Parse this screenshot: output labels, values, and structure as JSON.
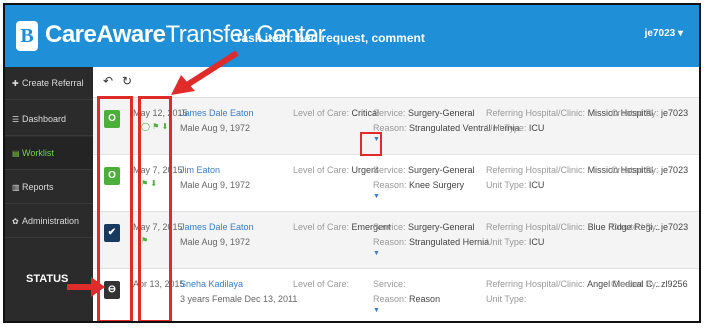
{
  "header": {
    "brand_bold": "CareAware",
    "brand_light": "Transfer Center",
    "user": "je7023 ▾",
    "logo_letter": "B"
  },
  "sidebar": {
    "items": [
      {
        "label": "Create Referral",
        "icon": "plus-icon"
      },
      {
        "label": "Dashboard",
        "icon": "grid-icon"
      },
      {
        "label": "Worklist",
        "icon": "list-icon"
      },
      {
        "label": "Reports",
        "icon": "chart-icon"
      },
      {
        "label": "Administration",
        "icon": "gear-icon"
      }
    ]
  },
  "toolbar": {
    "undo_icon": "undo-icon",
    "refresh_icon": "refresh-icon"
  },
  "annotations": {
    "task_label": "Task item: bed request, comment",
    "status_label": "STATUS",
    "color": "#e02b2b"
  },
  "rows": [
    {
      "status_color": "green",
      "status_icon": "circle-icon",
      "date": "May 12, 2015",
      "task_icons": "◯ ⚑ ⬇",
      "name": "James Dale Eaton",
      "info": "Male Aug 9, 1972",
      "care_label": "Level of Care:",
      "care": "Critical",
      "service_label": "Service:",
      "service": "Surgery-General",
      "reason_label": "Reason:",
      "reason": "Strangulated Ventral Hernia",
      "ref_label": "Referring Hospital/Clinic:",
      "ref": "Mission Hospital",
      "unit_label": "Unit Type:",
      "unit": "ICU",
      "created_label": "Created By:",
      "created": "je7023"
    },
    {
      "status_color": "green",
      "status_icon": "circle-icon",
      "date": "May 7, 2015",
      "task_icons": "⚑ ⬇",
      "name": "Jim Eaton",
      "info": "Male Aug 9, 1972",
      "care_label": "Level of Care:",
      "care": "Urgent",
      "service_label": "Service:",
      "service": "Surgery-General",
      "reason_label": "Reason:",
      "reason": "Knee Surgery",
      "ref_label": "Referring Hospital/Clinic:",
      "ref": "Mission Hospital",
      "unit_label": "Unit Type:",
      "unit": "ICU",
      "created_label": "Created By:",
      "created": "je7023"
    },
    {
      "status_color": "navy",
      "status_icon": "check-icon",
      "date": "May 7, 2015",
      "task_icons": "⚑",
      "name": "James Dale Eaton",
      "info": "Male Aug 9, 1972",
      "care_label": "Level of Care:",
      "care": "Emergent",
      "service_label": "Service:",
      "service": "Surgery-General",
      "reason_label": "Reason:",
      "reason": "Strangulated Hernia",
      "ref_label": "Referring Hospital/Clinic:",
      "ref": "Blue Ridge Regi...",
      "unit_label": "Unit Type:",
      "unit": "ICU",
      "created_label": "Created By:",
      "created": "je7023"
    },
    {
      "status_color": "dark",
      "status_icon": "minus-icon",
      "date": "Apr 13, 2015",
      "task_icons": "",
      "name": "Sneha Kadilaya",
      "info": "3 years Female Dec 13, 2011",
      "care_label": "Level of Care:",
      "care": "",
      "service_label": "Service:",
      "service": "",
      "reason_label": "Reason:",
      "reason": "Reason",
      "ref_label": "Referring Hospital/Clinic:",
      "ref": "Angel Medical C...",
      "unit_label": "Unit Type:",
      "unit": "",
      "created_label": "Created By:",
      "created": "zl9256"
    }
  ]
}
